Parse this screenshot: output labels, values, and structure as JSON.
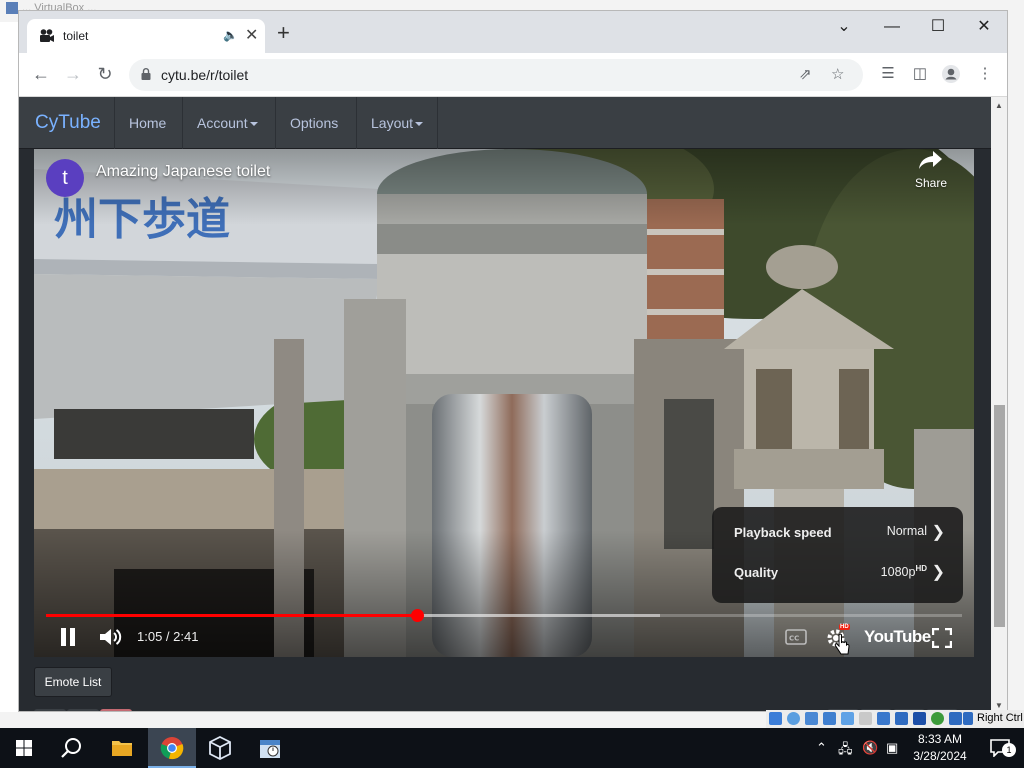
{
  "background_window": {
    "title": "... VirtualBox ..."
  },
  "browser": {
    "tab": {
      "title": "toilet",
      "favicon": "camera-icon",
      "audio_icon": "speaker-icon",
      "close_icon": "close-icon"
    },
    "new_tab_label": "+",
    "window_controls": {
      "dropdown": "chevron-down-icon",
      "minimize": "minimize-icon",
      "maximize": "maximize-icon",
      "close": "close-icon"
    },
    "url": "cytu.be/r/toilet"
  },
  "site": {
    "brand": "CyTube",
    "nav": [
      {
        "label": "Home",
        "dropdown": false
      },
      {
        "label": "Account",
        "dropdown": true
      },
      {
        "label": "Options",
        "dropdown": false
      },
      {
        "label": "Layout",
        "dropdown": true
      }
    ]
  },
  "video": {
    "channel_initial": "t",
    "title": "Amazing Japanese toilet",
    "share_label": "Share",
    "time": "1:05 / 2:41",
    "progress_played": 0.405,
    "progress_loaded": 0.67,
    "settings_menu": [
      {
        "label": "Playback speed",
        "value": "Normal",
        "badge": ""
      },
      {
        "label": "Quality",
        "value": "1080p",
        "badge": "HD"
      }
    ],
    "hd_badge": "HD",
    "logo_text": "YouTube"
  },
  "emote_list_label": "Emote List",
  "vbox": {
    "host_key": "Right Ctrl"
  },
  "taskbar": {
    "clock_time": "8:33 AM",
    "clock_date": "3/28/2024",
    "notification_count": "1"
  }
}
